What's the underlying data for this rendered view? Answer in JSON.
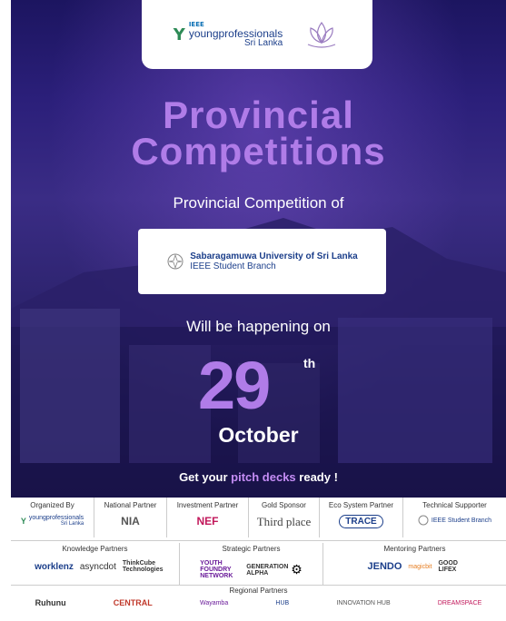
{
  "header": {
    "ieee_small": "IEEE",
    "ieee_main": "youngprofessionals",
    "ieee_region": "Sri Lanka"
  },
  "title": {
    "line1": "Provincial",
    "line2": "Competitions"
  },
  "subtitle": "Provincial Competition of",
  "university": {
    "name": "Sabaragamuwa University of Sri Lanka",
    "branch": "IEEE Student Branch"
  },
  "happening": "Will be happening on",
  "date": {
    "day": "29",
    "suffix": "th",
    "month": "October"
  },
  "pitch": {
    "pre": "Get your ",
    "highlight": "pitch decks",
    "post": " ready !"
  },
  "partners": {
    "organized_by": {
      "label": "Organized By",
      "logo": "youngprofessionals",
      "logo_sub": "Sri Lanka"
    },
    "national": {
      "label": "National Partner",
      "logo": "NIA"
    },
    "investment": {
      "label": "Investment Partner",
      "logo": "NEF"
    },
    "gold": {
      "label": "Gold Sponsor",
      "logo": "Third place"
    },
    "ecosystem": {
      "label": "Eco System Partner",
      "logo": "TRACE"
    },
    "technical": {
      "label": "Technical Supporter",
      "logo": "IEEE Student Branch"
    },
    "knowledge": {
      "label": "Knowledge Partners",
      "logos": [
        "worklenz",
        "asyncdot",
        "ThinkCube Technologies"
      ]
    },
    "strategic": {
      "label": "Strategic Partners",
      "logos": [
        "YOUTH FOUNDRY NETWORK",
        "GENERATION ALPHA"
      ]
    },
    "mentoring": {
      "label": "Mentoring Partners",
      "logos": [
        "JENDO",
        "magicbit",
        "GOOD LIFEX"
      ]
    },
    "regional": {
      "label": "Regional Partners",
      "logos": [
        "Ruhunu",
        "CENTRAL",
        "Wayamba",
        "HUB",
        "INNOVATION HUB",
        "DREAMSPACE"
      ]
    }
  },
  "colors": {
    "accent": "#b07ce8",
    "background": "#2b1f7a"
  }
}
